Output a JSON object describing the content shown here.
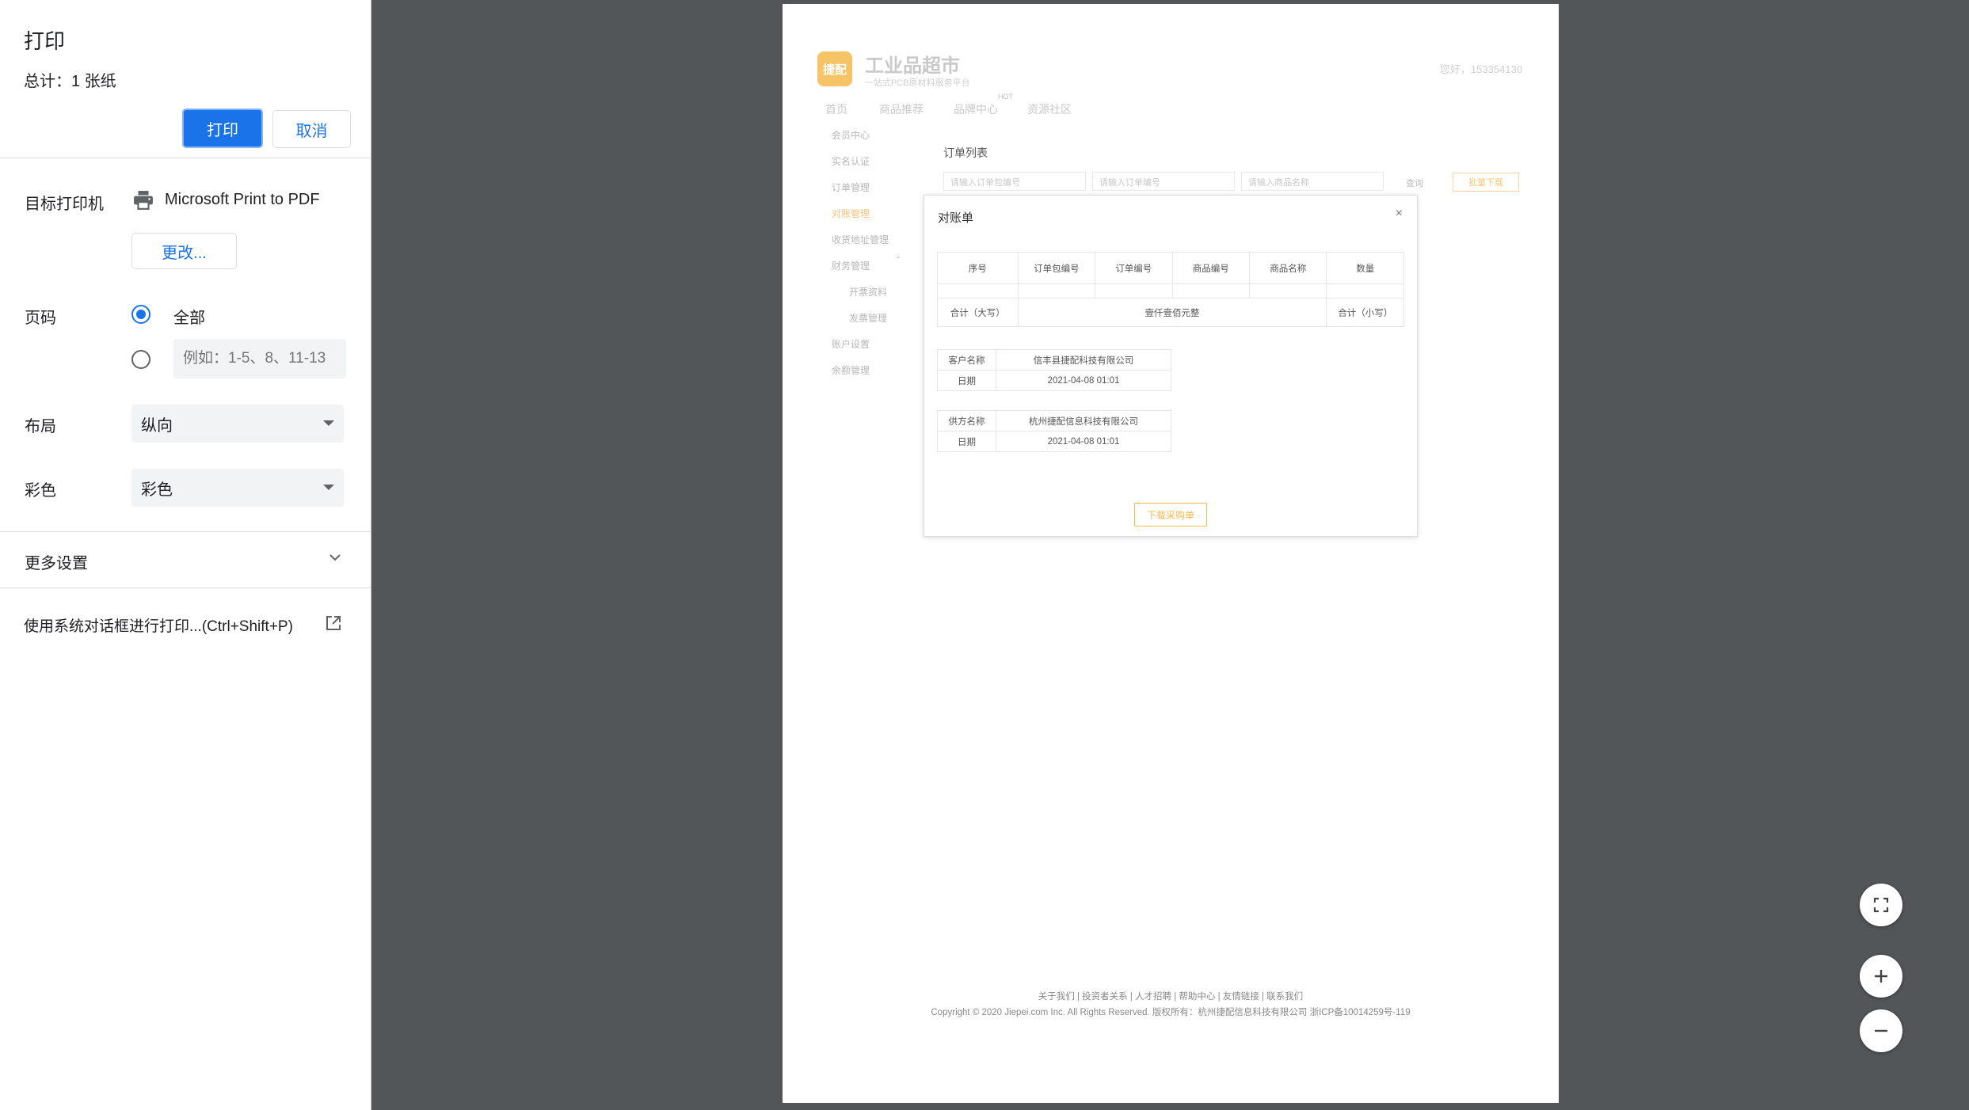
{
  "panel": {
    "title": "打印",
    "total": "总计：1 张纸",
    "print_label": "打印",
    "cancel_label": "取消",
    "destination": {
      "label": "目标打印机",
      "printer": "Microsoft Print to PDF",
      "change_label": "更改..."
    },
    "pages": {
      "label": "页码",
      "all_label": "全部",
      "all_selected": true,
      "custom_placeholder": "例如：1-5、8、11-13"
    },
    "layout": {
      "label": "布局",
      "value": "纵向"
    },
    "color": {
      "label": "彩色",
      "value": "彩色"
    },
    "more_settings": "更多设置",
    "system_dialog": "使用系统对话框进行打印...(Ctrl+Shift+P)",
    "accent_color": "#1a73e8"
  },
  "preview": {
    "logo_text": "捷配",
    "brand": "工业品超市",
    "brand_sub": "一站式PCB原材料服务平台",
    "greeting": "您好，153354130",
    "nav": [
      "首页",
      "商品推荐",
      "品牌中心",
      "资源社区"
    ],
    "nav_hot": "HOT",
    "sidebar": [
      "会员中心",
      "实名认证",
      "订单管理",
      "对账管理",
      "收货地址管理",
      "财务管理",
      "开票资料",
      "发票管理",
      "账户设置",
      "余额管理"
    ],
    "list_title": "订单列表",
    "search_placeholders": [
      "请输入订单包编号",
      "请输入订单编号",
      "请输入商品名称"
    ],
    "query_label": "查询",
    "bulk_download": "批量下载",
    "modal": {
      "title": "对账单",
      "close": "×",
      "columns": [
        "序号",
        "订单包编号",
        "订单编号",
        "商品编号",
        "商品名称",
        "数量"
      ],
      "total_upper_label": "合计（大写）",
      "total_upper_value": "壹仟壹佰元整",
      "total_lower_label": "合计（小写）",
      "customer": {
        "name_label": "客户名称",
        "name": "信丰县捷配科技有限公司",
        "date_label": "日期",
        "date": "2021-04-08 01:01"
      },
      "supplier": {
        "name_label": "供方名称",
        "name": "杭州捷配信息科技有限公司",
        "date_label": "日期",
        "date": "2021-04-08 01:01"
      },
      "download_label": "下载采购单"
    },
    "footer_links": "关于我们 | 投资者关系 | 人才招聘 | 帮助中心 | 友情链接 | 联系我们",
    "footer_copyright": "Copyright © 2020 Jiepei.com Inc. All Rights Reserved. 版权所有：杭州捷配信息科技有限公司  浙ICP备10014259号-119"
  },
  "zoom": {
    "fit_icon": "fit-to-page-icon",
    "zoom_in_icon": "zoom-in-icon",
    "zoom_out_icon": "zoom-out-icon"
  }
}
